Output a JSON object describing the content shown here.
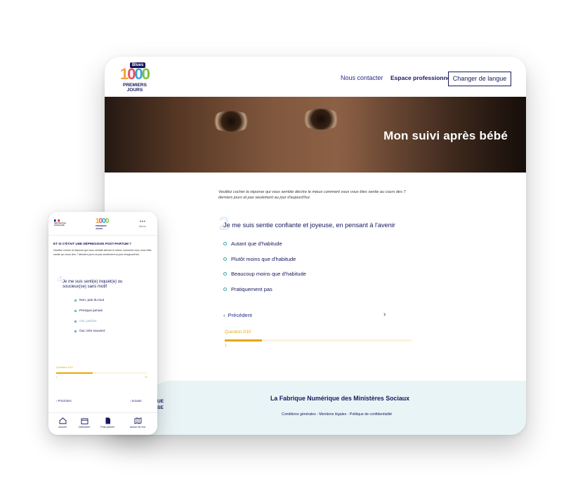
{
  "desktop": {
    "header": {
      "logo_badge": "Blues",
      "logo_number": [
        "1",
        "0",
        "0",
        "0"
      ],
      "logo_words": [
        "PREMIERS",
        "JOURS"
      ],
      "nav_contact": "Nous contacter",
      "nav_pro": "Espace professionnel",
      "lang_button": "Changer de langue"
    },
    "hero": {
      "title": "Mon suivi après bébé"
    },
    "quiz": {
      "intro": "Veuillez cocher la réponse qui vous semble décrire le mieux comment vous vous êtes sentie au cours des 7 derniers jours et pas seulement au jour d'aujourd'hui.",
      "question_number": "2",
      "question": "Je me suis sentie confiante et joyeuse, en pensant à l'avenir",
      "options": [
        "Autant que d'habitude",
        "Plutôt moins que d'habitude",
        "Beaucoup moins que d'habitude",
        "Pratiquement pas"
      ],
      "prev_label": "Précédent",
      "next_label": "›",
      "progress_label": "Question 2/10",
      "progress_fraction": 0.2,
      "progress_start": "1"
    },
    "footer": {
      "title": "La Fabrique Numérique des Ministères Sociaux",
      "links": "Conditions générales - Mentions légales - Politique de confidentialité",
      "peek_lines": [
        "UE",
        "SE"
      ]
    }
  },
  "mobile": {
    "gov_lines": [
      "RÉPUBLIQUE",
      "FRANÇAISE"
    ],
    "logo_number": [
      "1",
      "0",
      "0",
      "0"
    ],
    "logo_words": [
      "PREMIERS",
      "JOURS"
    ],
    "menu_label": "Menu",
    "heading": "ET SI C'ÉTAIT UNE DÉPRESSION POST-PARTUM ?",
    "intro": "Veuillez cocher la réponse qui vous semble décrire le mieux comment vous vous êtes sentie au cours des 7 derniers jours et pas seulement au jour d'aujourd'hui.",
    "question_number": "4",
    "question": "Je me suis senti(e) inquiet(e) ou soucieux(se) sans motif",
    "options": [
      "Non, pas du tout",
      "Presque jamais",
      "Oui, parfois",
      "Oui, très souvent"
    ],
    "selected_option_index": 2,
    "progress_label": "Question 4/10",
    "progress_fraction": 0.4,
    "progress_start": "1",
    "progress_end": "10",
    "prev_label": "‹ Précédent",
    "next_label": "› Suivant",
    "tabs": [
      {
        "label": "Accueil",
        "icon": "home-icon"
      },
      {
        "label": "Calendrier",
        "icon": "calendar-icon"
      },
      {
        "label": "Post-partum",
        "icon": "document-icon"
      },
      {
        "label": "Autour de moi",
        "icon": "map-icon"
      }
    ]
  },
  "colors": {
    "navy": "#17175e",
    "accent_yellow": "#e8a800",
    "footer_bg": "#e9f4f6",
    "radio_teal": "#3aa3a3"
  }
}
